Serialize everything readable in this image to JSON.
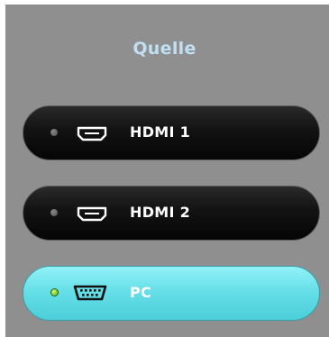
{
  "menu": {
    "title": "Quelle",
    "items": [
      {
        "label": "HDMI 1",
        "icon": "hdmi-port-icon",
        "selected": false
      },
      {
        "label": "HDMI 2",
        "icon": "hdmi-port-icon",
        "selected": false
      },
      {
        "label": "PC",
        "icon": "vga-port-icon",
        "selected": true
      }
    ]
  },
  "colors": {
    "title": "#bfe0f4",
    "background": "#8f8f8f",
    "item_inactive": "#141414",
    "item_active": "#66dfe8",
    "led_on": "#7fd430",
    "led_off": "#6a6a6a"
  }
}
